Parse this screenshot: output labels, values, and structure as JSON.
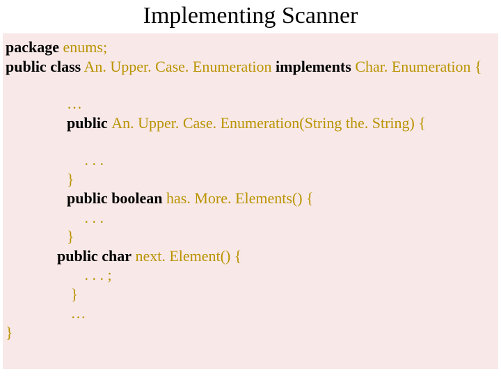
{
  "title": "Implementing Scanner",
  "code": {
    "l1a": "package",
    "l1b": " enums;",
    "l2a": "public class",
    "l2b": " An. Upper. Case. Enumeration ",
    "l2c": "implements",
    "l2d": " Char. Enumeration {",
    "l3": "…",
    "l4a": "public ",
    "l4b": "An. Upper. Case. Enumeration(String the. String) {",
    "l5": " . . .",
    "l6": "}",
    "l7a": "public boolean",
    "l7b": " has. More. Elements() {",
    "l8": " . . .",
    "l9": "}",
    "l10a": "public char",
    "l10b": " next. Element() {",
    "l11": " . . . ;",
    "l12": " }",
    "l13": " …",
    "l14": "}"
  }
}
